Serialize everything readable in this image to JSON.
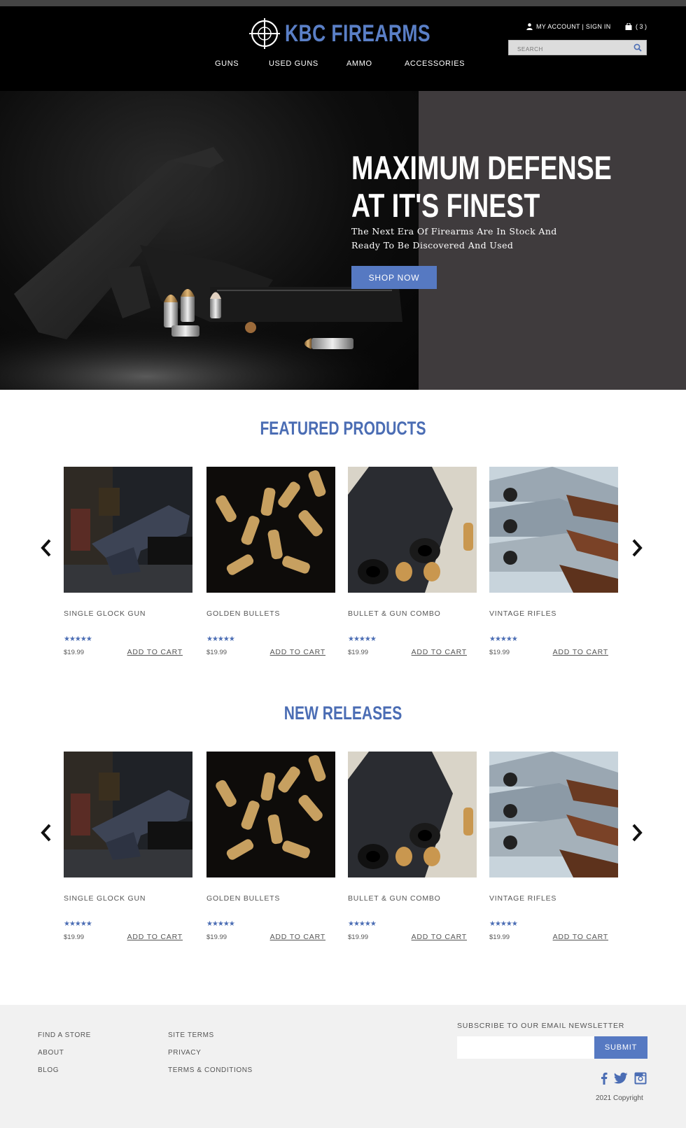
{
  "brand": {
    "name": "KBC FIREARMS",
    "color": "#5a7fc6"
  },
  "nav": {
    "items": [
      "GUNS",
      "USED GUNS",
      "AMMO",
      "ACCESSORIES"
    ]
  },
  "account": {
    "label": "MY ACCOUNT | SIGN IN",
    "icon": "user-icon"
  },
  "cart": {
    "count_label": "( 3 )",
    "icon": "shopping-bag-icon"
  },
  "search": {
    "placeholder": "SEARCH",
    "icon": "search-icon"
  },
  "hero": {
    "title_line1": "MAXIMUM DEFENSE",
    "title_line2": "AT IT'S FINEST",
    "subtitle": "The Next Era Of Firearms Are In Stock And Ready To Be Discovered And Used",
    "cta": "SHOP NOW"
  },
  "featured": {
    "title": "FEATURED PRODUCTS",
    "products": [
      {
        "name": "SINGLE GLOCK GUN",
        "rating": "★★★★★",
        "price": "$19.99",
        "cta": "ADD TO CART"
      },
      {
        "name": "GOLDEN BULLETS",
        "rating": "★★★★★",
        "price": "$19.99",
        "cta": "ADD TO CART"
      },
      {
        "name": "BULLET & GUN COMBO",
        "rating": "★★★★★",
        "price": "$19.99",
        "cta": "ADD TO CART"
      },
      {
        "name": "VINTAGE RIFLES",
        "rating": "★★★★★",
        "price": "$19.99",
        "cta": "ADD TO CART"
      }
    ]
  },
  "new_releases": {
    "title": "NEW RELEASES",
    "products": [
      {
        "name": "SINGLE GLOCK GUN",
        "rating": "★★★★★",
        "price": "$19.99",
        "cta": "ADD TO CART"
      },
      {
        "name": "GOLDEN BULLETS",
        "rating": "★★★★★",
        "price": "$19.99",
        "cta": "ADD TO CART"
      },
      {
        "name": "BULLET & GUN COMBO",
        "rating": "★★★★★",
        "price": "$19.99",
        "cta": "ADD TO CART"
      },
      {
        "name": "VINTAGE RIFLES",
        "rating": "★★★★★",
        "price": "$19.99",
        "cta": "ADD TO CART"
      }
    ]
  },
  "footer": {
    "col1": [
      "FIND A STORE",
      "ABOUT",
      "BLOG"
    ],
    "col2": [
      "SITE TERMS",
      "PRIVACY",
      "TERMS & CONDITIONS"
    ],
    "newsletter_label": "SUBSCRIBE TO OUR EMAIL NEWSLETTER",
    "submit": "SUBMIT",
    "social_icons": [
      "facebook-icon",
      "twitter-icon",
      "instagram-icon"
    ],
    "copyright": "2021 Copyright"
  },
  "colors": {
    "accent": "#5679c2",
    "heading": "#4b6db4",
    "header_bg": "#000000",
    "hero_bg": "#3f3b3d",
    "footer_bg": "#f1f1f1"
  }
}
